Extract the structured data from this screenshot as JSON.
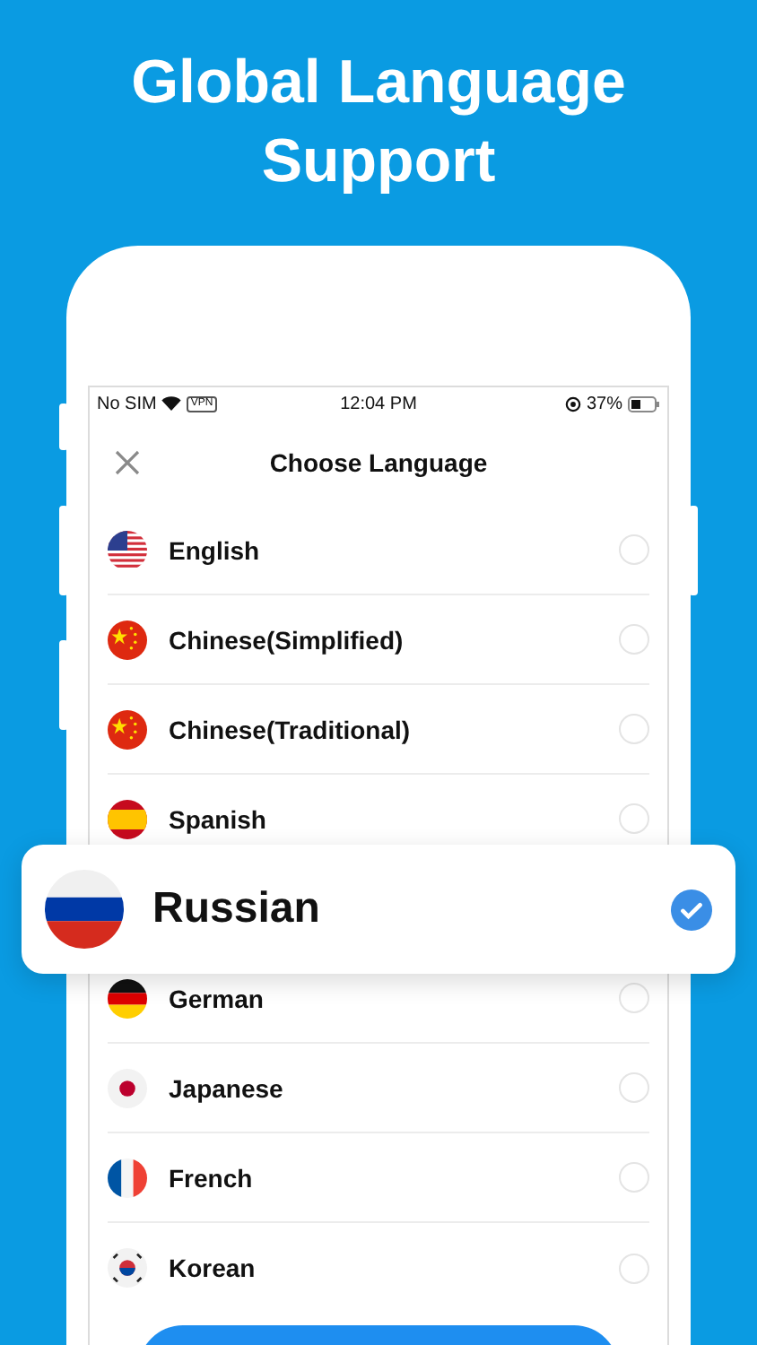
{
  "headline": "Global Language Support",
  "status_bar": {
    "carrier": "No SIM",
    "vpn": "VPN",
    "time": "12:04 PM",
    "battery": "37%"
  },
  "header": {
    "title": "Choose Language"
  },
  "languages": [
    {
      "name": "English",
      "kind": "us",
      "selected": false
    },
    {
      "name": "Chinese(Simplified)",
      "kind": "cn",
      "selected": false
    },
    {
      "name": "Chinese(Traditional)",
      "kind": "cn",
      "selected": false
    },
    {
      "name": "Spanish",
      "kind": "es",
      "selected": false
    },
    {
      "name": "Russian",
      "kind": "ru",
      "selected": true
    },
    {
      "name": "German",
      "kind": "de",
      "selected": false
    },
    {
      "name": "Japanese",
      "kind": "jp",
      "selected": false
    },
    {
      "name": "French",
      "kind": "fr",
      "selected": false
    },
    {
      "name": "Korean",
      "kind": "kr",
      "selected": false
    }
  ]
}
